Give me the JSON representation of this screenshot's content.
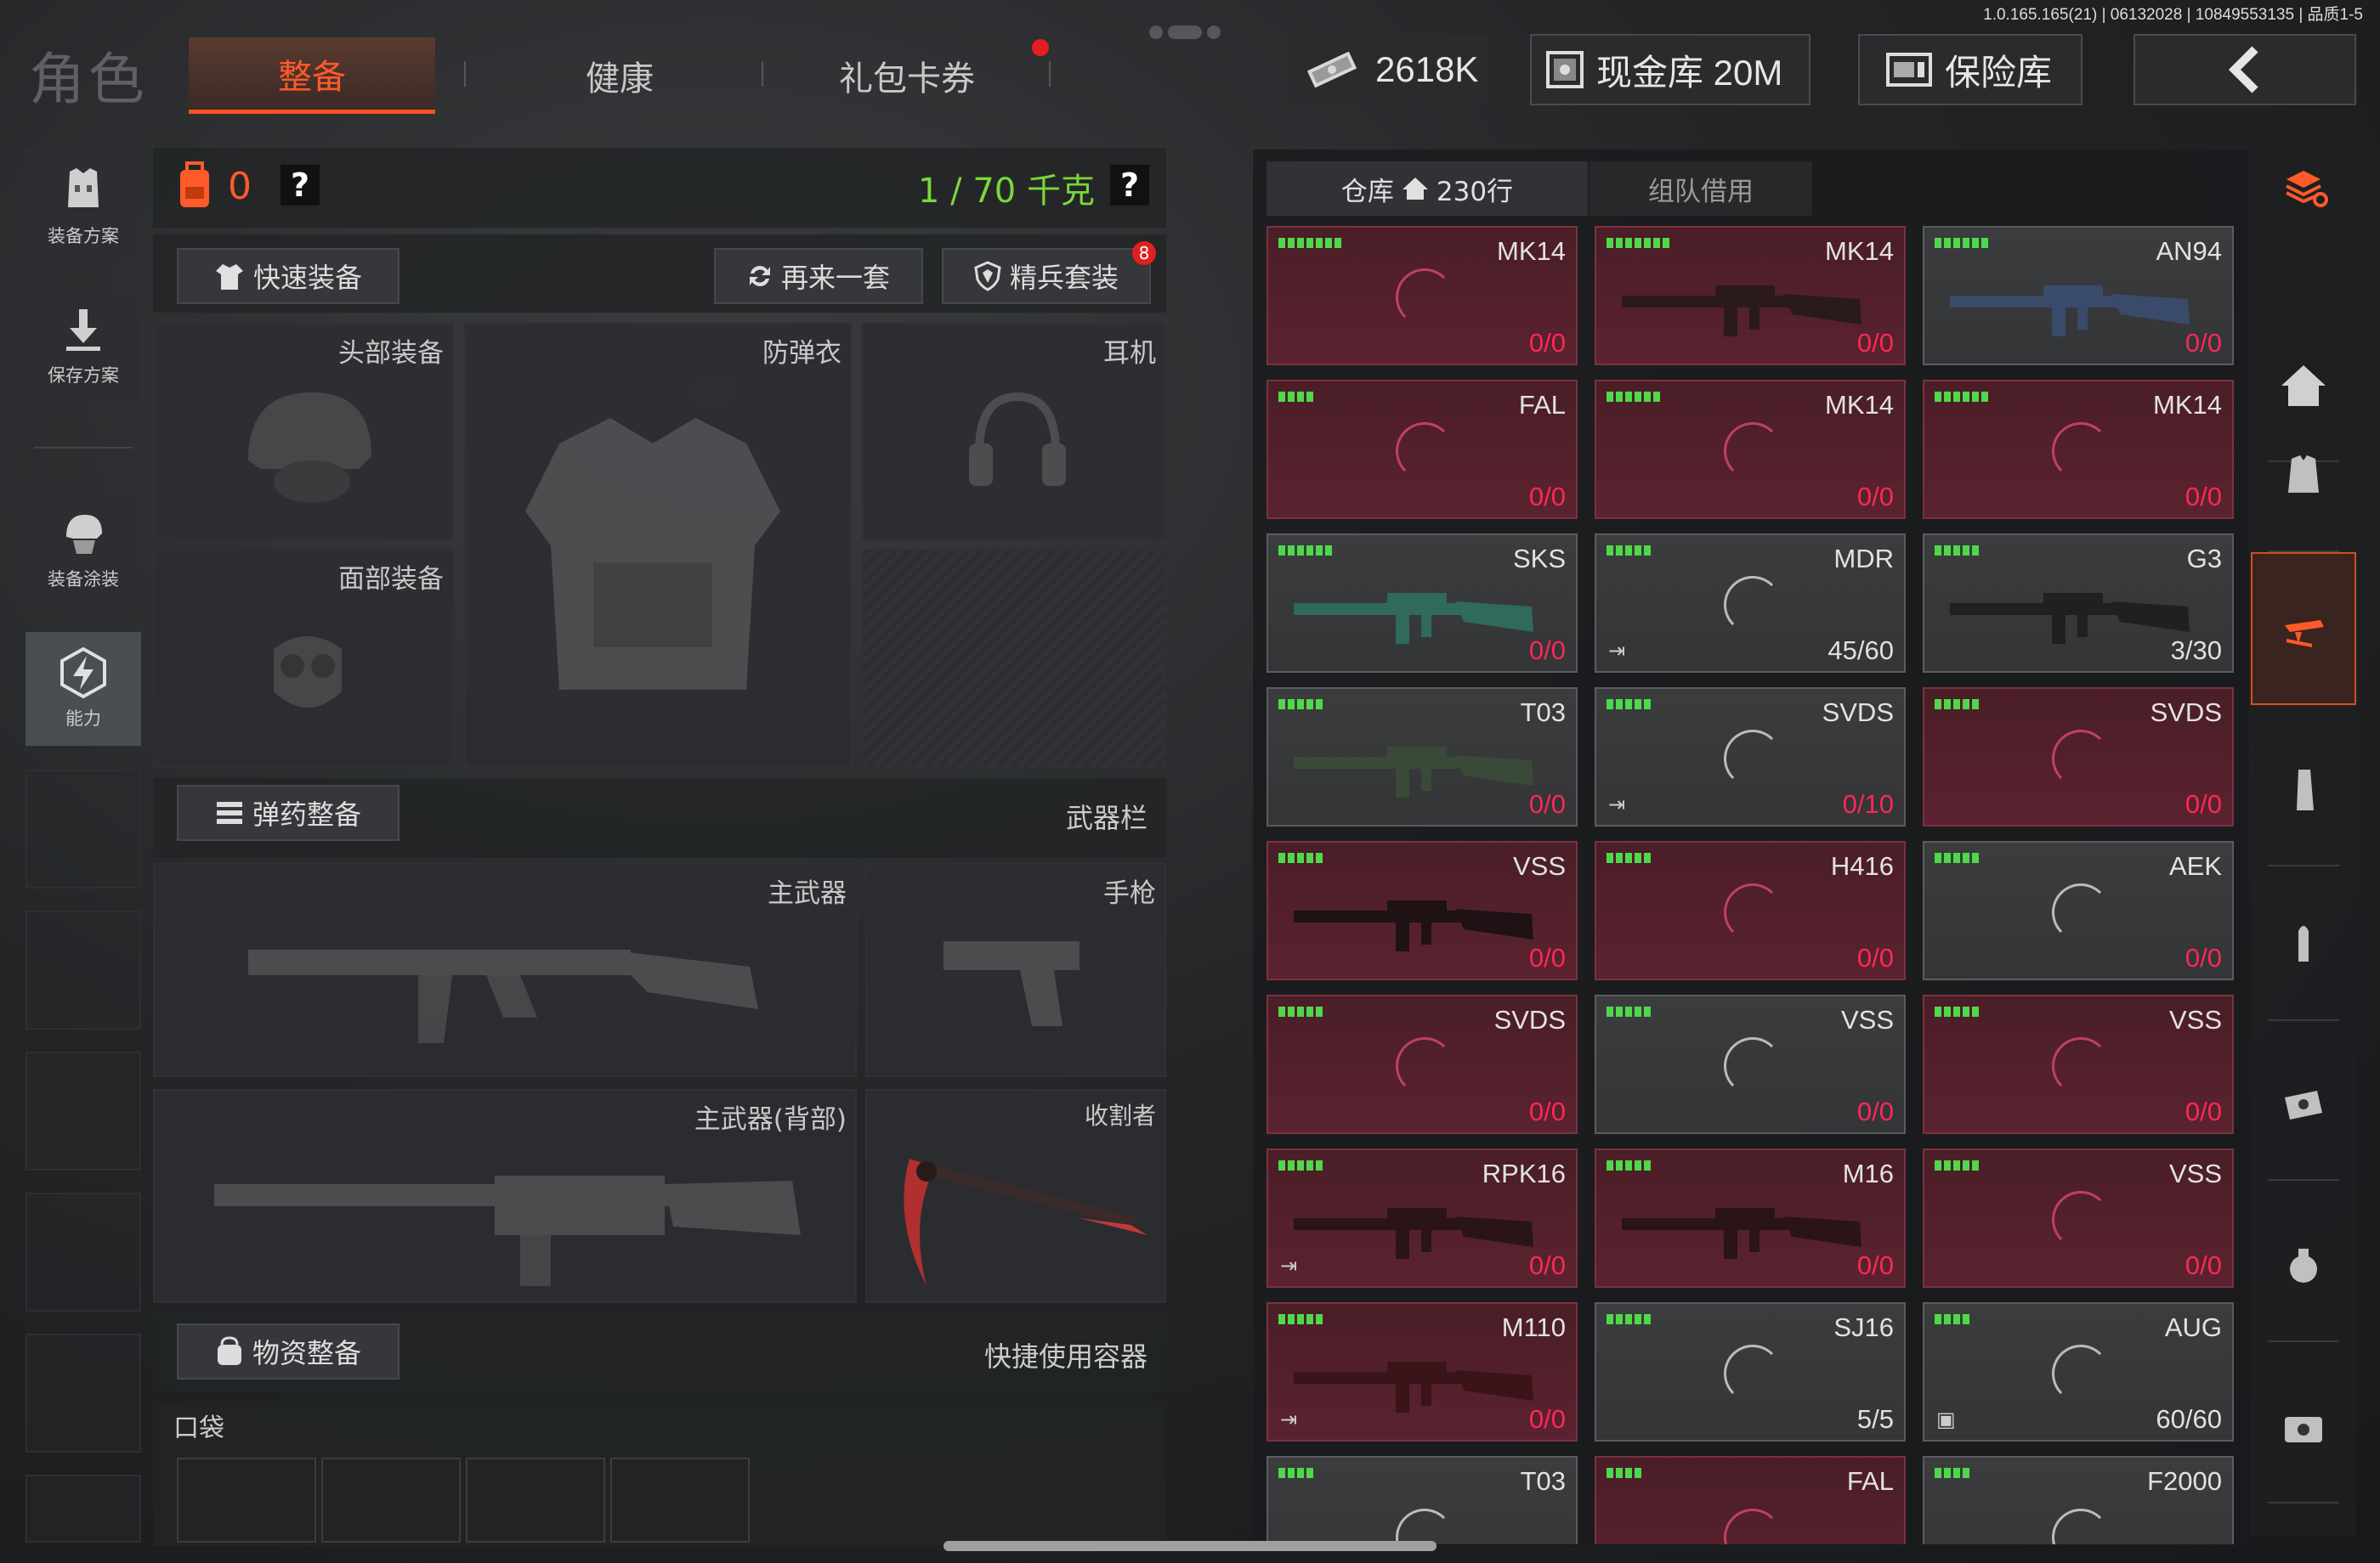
{
  "version_text": "1.0.165.165(21) | 06132028 | 10849553135 | 品质1-5",
  "page_title": "角色",
  "tabs": [
    "整备",
    "健康",
    "礼包卡券"
  ],
  "currency": {
    "label": "2618K"
  },
  "cash_vault": {
    "label": "现金库 20M"
  },
  "insurance": {
    "label": "保险库"
  },
  "left_nav": [
    {
      "label": "装备方案",
      "icon": "armor-plan-icon"
    },
    {
      "label": "保存方案",
      "icon": "save-arrow-icon"
    },
    {
      "label": "装备涂装",
      "icon": "helmet-skin-icon"
    },
    {
      "label": "能力",
      "icon": "ability-bolt-icon"
    }
  ],
  "loadout": {
    "backpack_count": "0",
    "help": "?",
    "weight": "1 / 70 千克",
    "quick_equip": "快速装备",
    "reroll": "再来一套",
    "elite_kit": "精兵套装",
    "elite_badge": "8",
    "slots": {
      "head": "头部装备",
      "vest": "防弹衣",
      "earphone": "耳机",
      "face": "面部装备",
      "main_weapon": "主武器",
      "pistol": "手枪",
      "main_weapon_back": "主武器(背部)",
      "melee": "收割者"
    },
    "ammo_section": "弹药整备",
    "weapon_bar": "武器栏",
    "supply_section": "物资整备",
    "quick_container": "快捷使用容器",
    "pocket": "口袋"
  },
  "warehouse": {
    "tab_label": "仓库",
    "tab_count": "230行",
    "team_borrow": "组队借用"
  },
  "items": [
    {
      "name": "MK14",
      "qty_a": "0",
      "qty_b": "/0",
      "style": "red",
      "bars": 7,
      "gun": false,
      "mark": ""
    },
    {
      "name": "MK14",
      "qty_a": "0",
      "qty_b": "/0",
      "style": "red",
      "bars": 7,
      "gun": true,
      "gun_color": "#2a1a1c",
      "mark": ""
    },
    {
      "name": "AN94",
      "qty_a": "0",
      "qty_b": "/0",
      "style": "grey",
      "bars": 6,
      "gun": true,
      "gun_color": "#3a4a6a",
      "mark": ""
    },
    {
      "name": "FAL",
      "qty_a": "0",
      "qty_b": "/0",
      "style": "red",
      "bars": 4,
      "gun": false,
      "mark": ""
    },
    {
      "name": "MK14",
      "qty_a": "0",
      "qty_b": "/0",
      "style": "red",
      "bars": 6,
      "gun": false,
      "mark": ""
    },
    {
      "name": "MK14",
      "qty_a": "0",
      "qty_b": "/0",
      "style": "red",
      "bars": 6,
      "gun": false,
      "mark": ""
    },
    {
      "name": "SKS",
      "qty_a": "0",
      "qty_b": "/0",
      "style": "grey",
      "bars": 6,
      "gun": true,
      "gun_color": "#2f6a5a",
      "mark": ""
    },
    {
      "name": "MDR",
      "qty_a": "",
      "qty_b": "45/60",
      "style": "grey",
      "bars": 5,
      "gun": false,
      "mark": "⇥"
    },
    {
      "name": "G3",
      "qty_a": "",
      "qty_b": "3/30",
      "style": "grey",
      "bars": 5,
      "gun": true,
      "gun_color": "#1f2020",
      "mark": ""
    },
    {
      "name": "T03",
      "qty_a": "0",
      "qty_b": "/0",
      "style": "grey",
      "bars": 5,
      "gun": true,
      "gun_color": "#3a4a38",
      "mark": ""
    },
    {
      "name": "SVDS",
      "qty_a": "0",
      "qty_b": "/10",
      "style": "grey",
      "bars": 5,
      "gun": false,
      "mark": "⇥"
    },
    {
      "name": "SVDS",
      "qty_a": "0",
      "qty_b": "/0",
      "style": "red",
      "bars": 5,
      "gun": false,
      "mark": ""
    },
    {
      "name": "VSS",
      "qty_a": "0",
      "qty_b": "/0",
      "style": "red",
      "bars": 5,
      "gun": true,
      "gun_color": "#1e1214",
      "mark": ""
    },
    {
      "name": "H416",
      "qty_a": "0",
      "qty_b": "/0",
      "style": "red",
      "bars": 5,
      "gun": false,
      "mark": ""
    },
    {
      "name": "AEK",
      "qty_a": "0",
      "qty_b": "/0",
      "style": "grey",
      "bars": 5,
      "gun": false,
      "mark": ""
    },
    {
      "name": "SVDS",
      "qty_a": "0",
      "qty_b": "/0",
      "style": "red",
      "bars": 5,
      "gun": false,
      "mark": ""
    },
    {
      "name": "VSS",
      "qty_a": "0",
      "qty_b": "/0",
      "style": "grey",
      "bars": 5,
      "gun": false,
      "mark": ""
    },
    {
      "name": "VSS",
      "qty_a": "0",
      "qty_b": "/0",
      "style": "red",
      "bars": 5,
      "gun": false,
      "mark": ""
    },
    {
      "name": "RPK16",
      "qty_a": "0",
      "qty_b": "/0",
      "style": "red",
      "bars": 5,
      "gun": true,
      "gun_color": "#2a1416",
      "mark": "⇥"
    },
    {
      "name": "M16",
      "qty_a": "0",
      "qty_b": "/0",
      "style": "red",
      "bars": 5,
      "gun": true,
      "gun_color": "#2a1416",
      "mark": ""
    },
    {
      "name": "VSS",
      "qty_a": "0",
      "qty_b": "/0",
      "style": "red",
      "bars": 5,
      "gun": false,
      "mark": ""
    },
    {
      "name": "M110",
      "qty_a": "0",
      "qty_b": "/0",
      "style": "red",
      "bars": 5,
      "gun": true,
      "gun_color": "#3a1418",
      "mark": "⇥"
    },
    {
      "name": "SJ16",
      "qty_a": "",
      "qty_b": "5/5",
      "style": "grey",
      "bars": 5,
      "gun": false,
      "mark": ""
    },
    {
      "name": "AUG",
      "qty_a": "",
      "qty_b": "60/60",
      "style": "grey",
      "bars": 4,
      "gun": false,
      "mark": "▣"
    },
    {
      "name": "T03",
      "qty_a": "",
      "qty_b": "",
      "style": "grey",
      "bars": 4,
      "gun": false,
      "mark": ""
    },
    {
      "name": "FAL",
      "qty_a": "",
      "qty_b": "",
      "style": "red",
      "bars": 4,
      "gun": false,
      "mark": ""
    },
    {
      "name": "F2000",
      "qty_a": "",
      "qty_b": "",
      "style": "grey",
      "bars": 4,
      "gun": false,
      "mark": ""
    }
  ],
  "right_nav": [
    "refresh-stack-icon",
    "home-icon",
    "armor-vest-icon",
    "weapon-rack-icon",
    "magazine-icon",
    "bullet-icon",
    "scope-icon",
    "grenade-icon",
    "container-icon"
  ],
  "colors": {
    "accent": "#ff5020",
    "red_card": "#5b2230",
    "green_bars": "#4fd84a",
    "qty_red": "#ff2855"
  }
}
